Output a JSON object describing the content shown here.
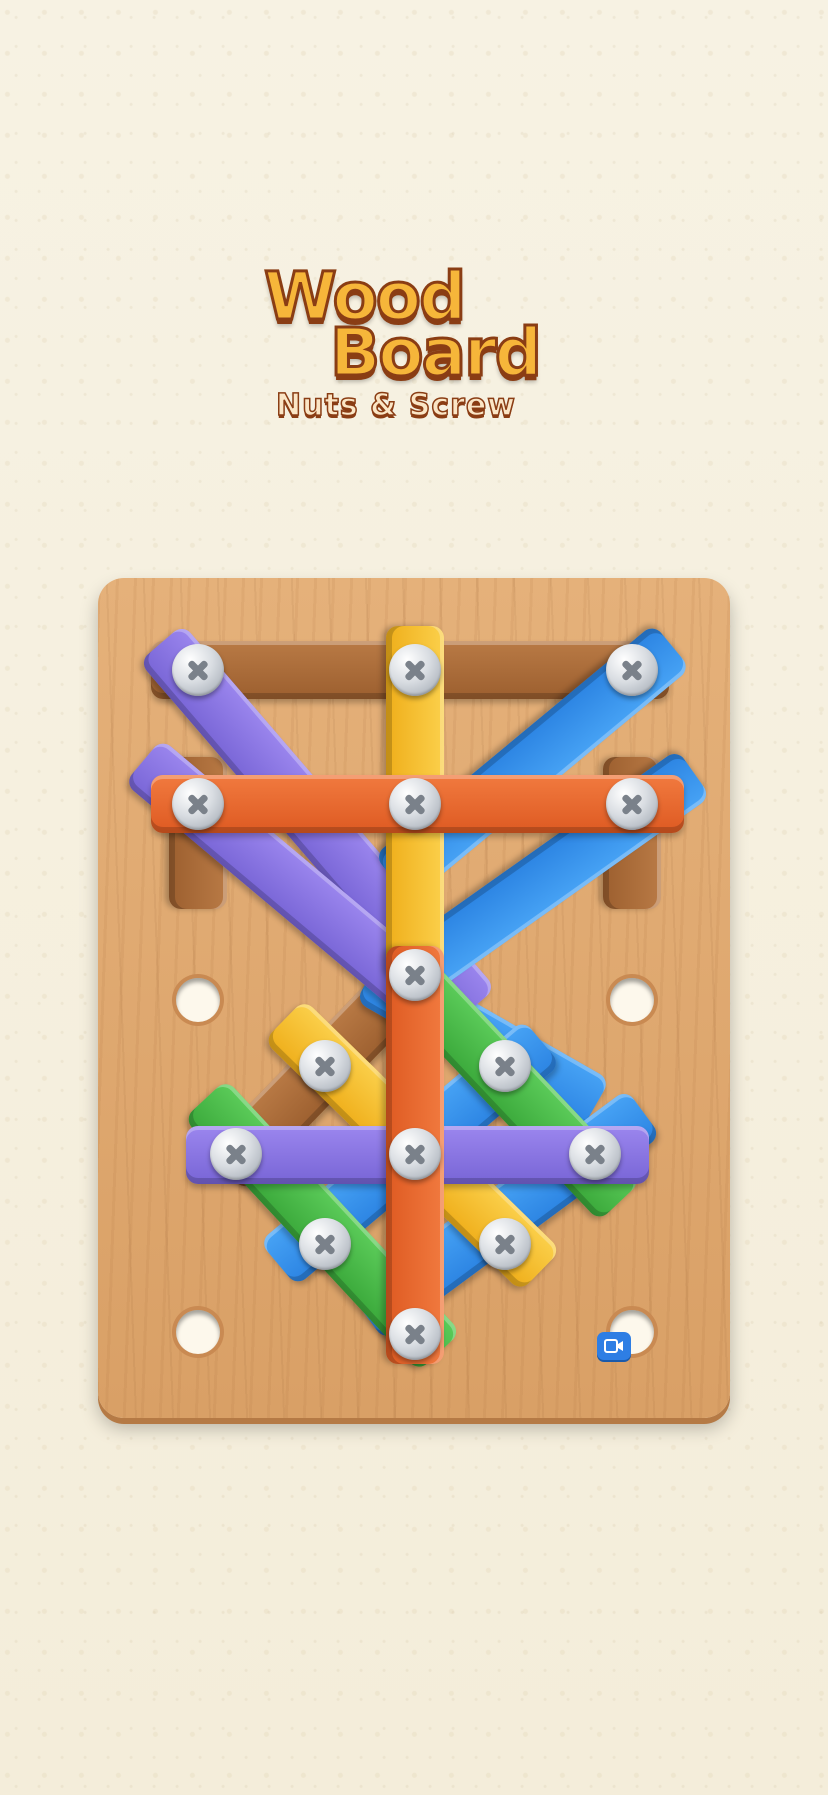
{
  "logo": {
    "line1": "Wood",
    "line2": "Board",
    "line3": "Nuts & Screw"
  },
  "colors": {
    "purple": "#7865d6",
    "blue": "#2b83e2",
    "yellow": "#efae1a",
    "orange": "#de5a22",
    "green": "#3aa83a",
    "brown": "#9c5f2f",
    "board": "#d9a066"
  },
  "icons": [
    "screw-icon",
    "hole-icon",
    "video-icon"
  ]
}
